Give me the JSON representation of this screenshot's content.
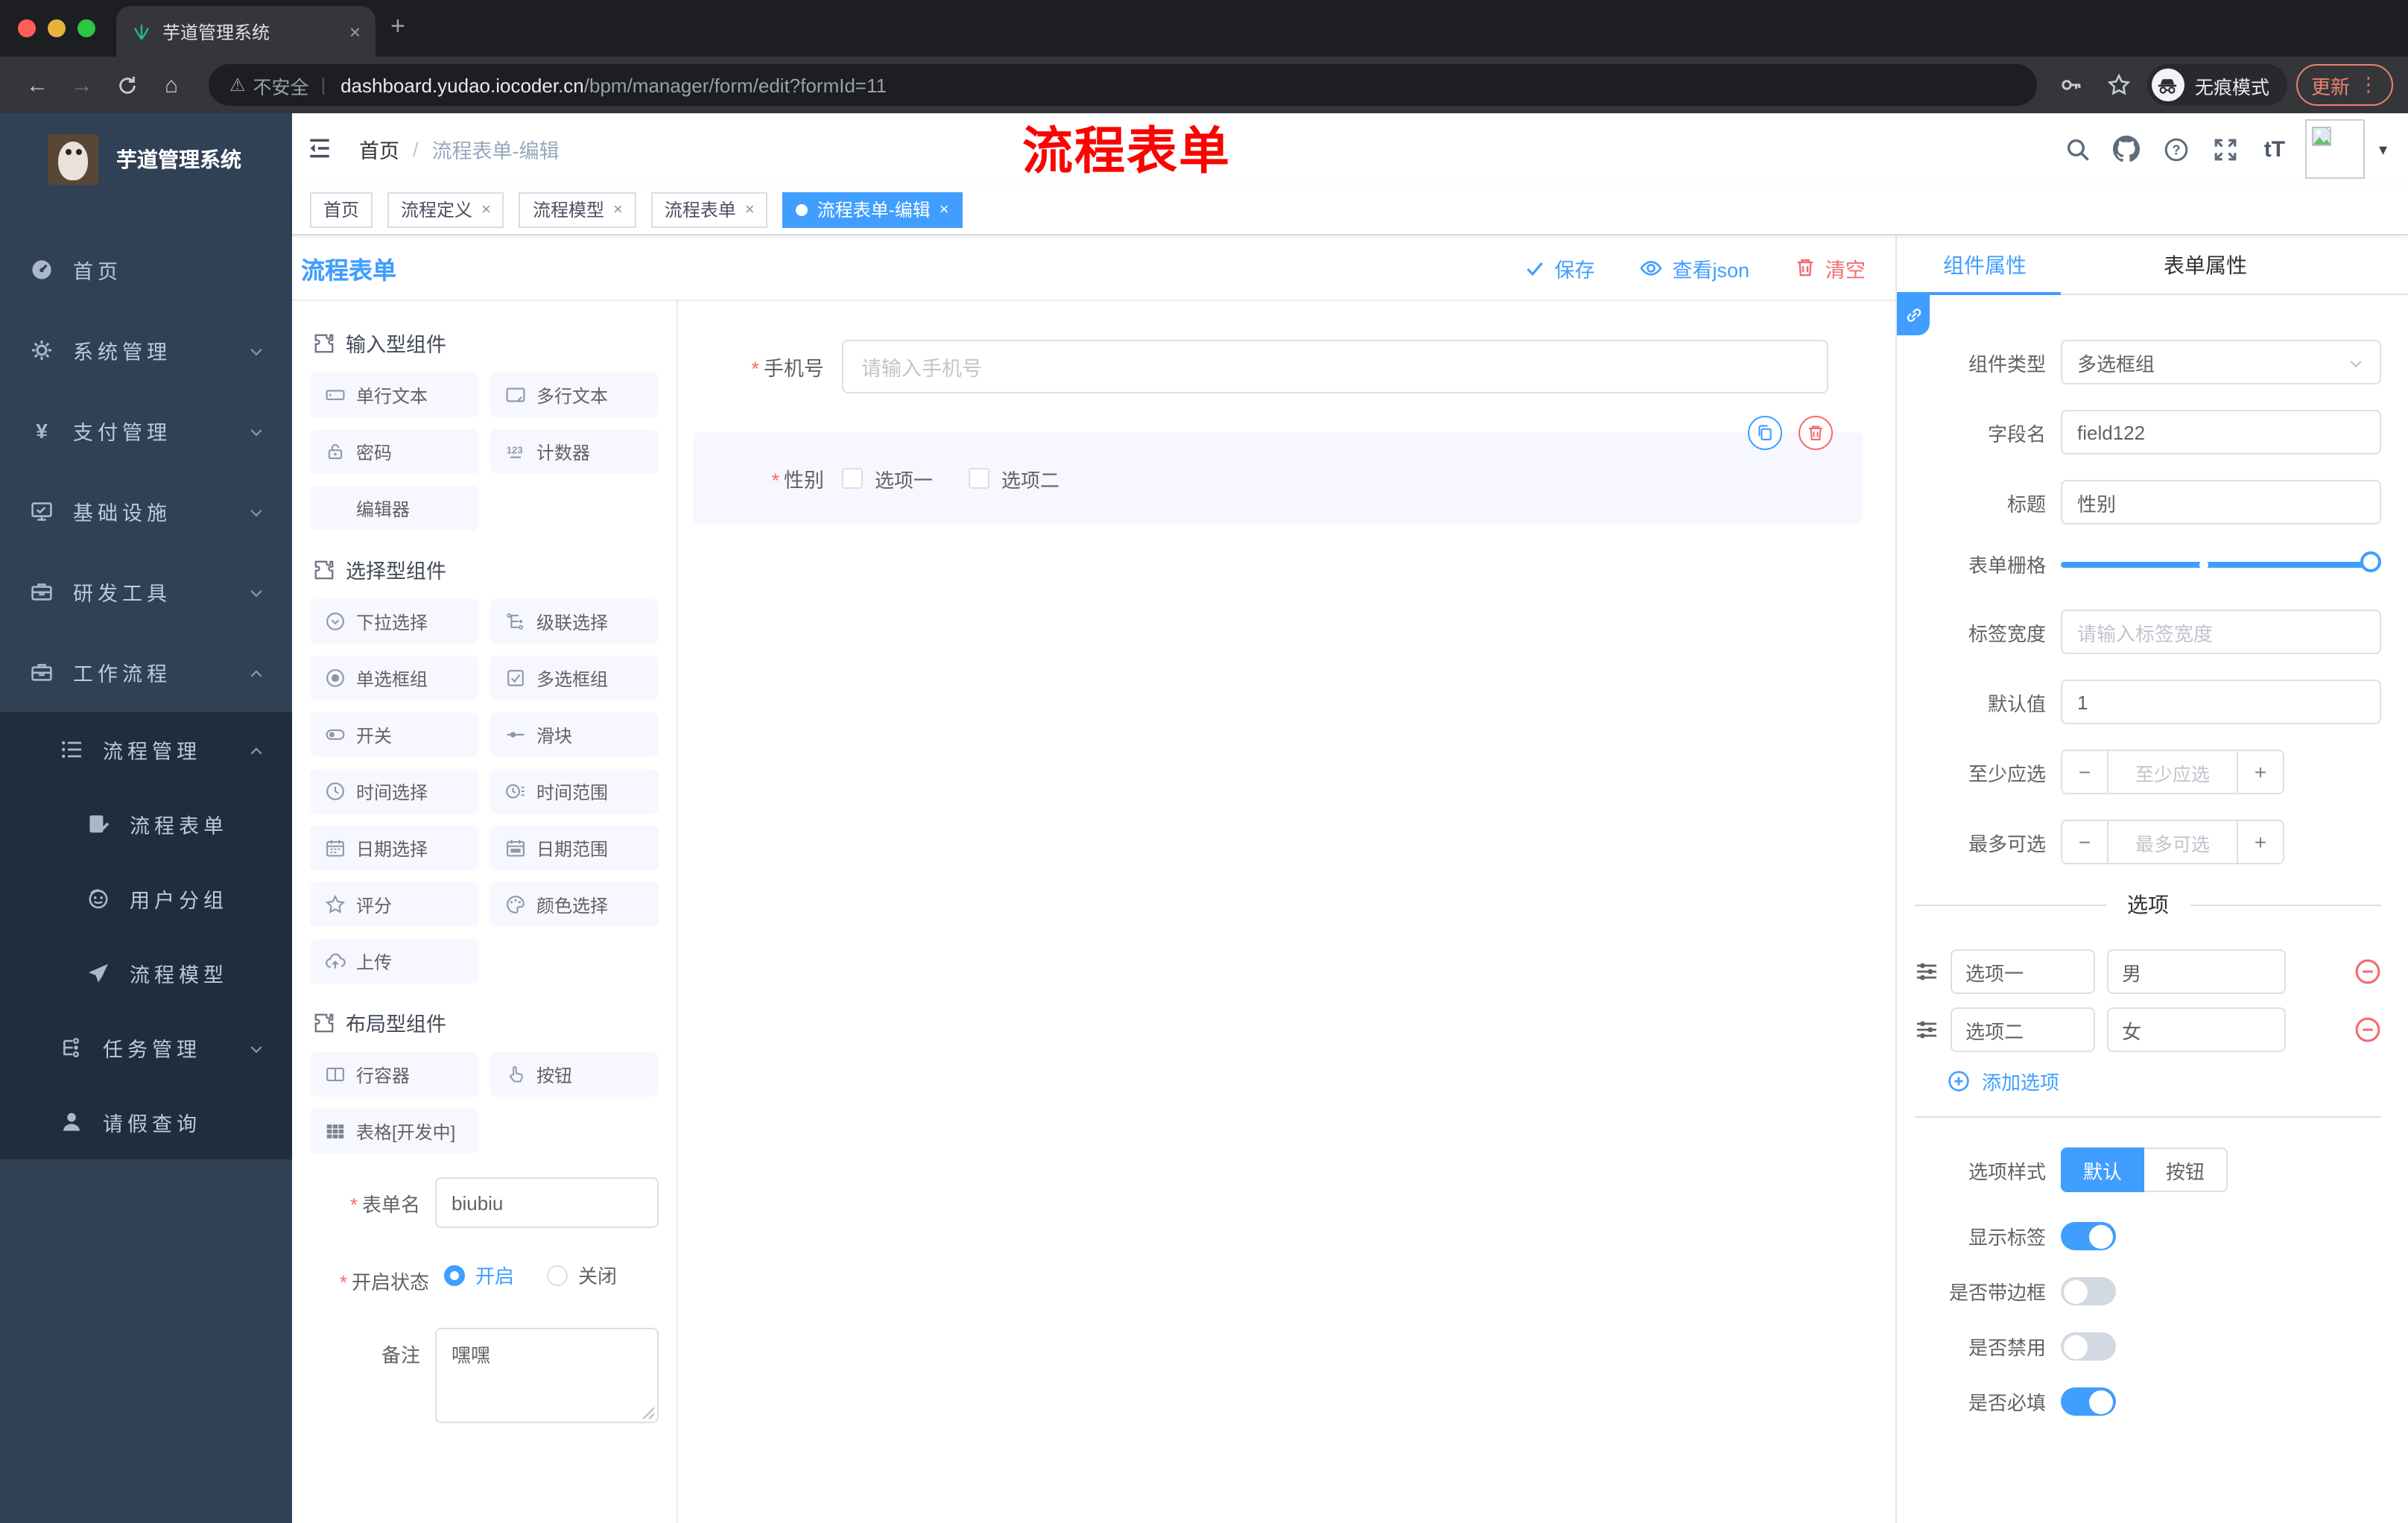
{
  "misc": {
    "required": "*",
    "minus": "−",
    "plus": "+",
    "close": "×",
    "new_tab": "+",
    "dots": "⋮",
    "caret": "▾",
    "slash": "/",
    "warn": "⚠",
    "back": "←",
    "forward": "→",
    "home": "⌂",
    "pipe": "|",
    "font_size": "tT"
  },
  "colors": {
    "primary": "#409eff",
    "danger": "#f56c6c",
    "annotation_red": "#fb0300",
    "sidebar_bg": "#304156",
    "sidebar_sub_bg": "#1f2d3d"
  },
  "browser": {
    "tab_title": "芋道管理系统",
    "not_secure": "不安全",
    "url_host": "dashboard.yudao.iocoder.cn",
    "url_path": "/bpm/manager/form/edit?formId=11",
    "incognito_label": "无痕模式",
    "update_label": "更新"
  },
  "sidebar": {
    "brand": "芋道管理系统",
    "items": [
      {
        "label": "首页"
      },
      {
        "label": "系统管理"
      },
      {
        "label": "支付管理"
      },
      {
        "label": "基础设施"
      },
      {
        "label": "研发工具"
      },
      {
        "label": "工作流程"
      },
      {
        "label": "流程管理"
      },
      {
        "label": "流程表单"
      },
      {
        "label": "用户分组"
      },
      {
        "label": "流程模型"
      },
      {
        "label": "任务管理"
      },
      {
        "label": "请假查询"
      }
    ]
  },
  "header": {
    "breadcrumb_home": "首页",
    "breadcrumb_current": "流程表单-编辑",
    "annotation": "流程表单"
  },
  "tags": [
    {
      "label": "首页"
    },
    {
      "label": "流程定义"
    },
    {
      "label": "流程模型"
    },
    {
      "label": "流程表单"
    },
    {
      "label": "流程表单-编辑"
    }
  ],
  "designer": {
    "title": "流程表单",
    "toolbar": {
      "save": "保存",
      "view_json": "查看json",
      "clear": "清空"
    },
    "sections": [
      {
        "title": "输入型组件",
        "items": [
          {
            "label": "单行文本"
          },
          {
            "label": "多行文本"
          },
          {
            "label": "密码"
          },
          {
            "label": "计数器"
          },
          {
            "label": "编辑器"
          }
        ]
      },
      {
        "title": "选择型组件",
        "items": [
          {
            "label": "下拉选择"
          },
          {
            "label": "级联选择"
          },
          {
            "label": "单选框组"
          },
          {
            "label": "多选框组"
          },
          {
            "label": "开关"
          },
          {
            "label": "滑块"
          },
          {
            "label": "时间选择"
          },
          {
            "label": "时间范围"
          },
          {
            "label": "日期选择"
          },
          {
            "label": "日期范围"
          },
          {
            "label": "评分"
          },
          {
            "label": "颜色选择"
          },
          {
            "label": "上传"
          }
        ]
      },
      {
        "title": "布局型组件",
        "items": [
          {
            "label": "行容器"
          },
          {
            "label": "按钮"
          },
          {
            "label": "表格[开发中]"
          }
        ]
      }
    ],
    "form": {
      "name_label": "表单名",
      "name_value": "biubiu",
      "status_label": "开启状态",
      "status_on": "开启",
      "status_off": "关闭",
      "remark_label": "备注",
      "remark_value": "嘿嘿"
    }
  },
  "canvas": {
    "phone_label": "手机号",
    "phone_placeholder": "请输入手机号",
    "gender_label": "性别",
    "gender_options": [
      {
        "label": "选项一"
      },
      {
        "label": "选项二"
      }
    ]
  },
  "panel": {
    "tab_component": "组件属性",
    "tab_form": "表单属性",
    "component_type_label": "组件类型",
    "component_type_value": "多选框组",
    "field_name_label": "字段名",
    "field_name_value": "field122",
    "title_label": "标题",
    "title_value": "性别",
    "grid_label": "表单栅格",
    "label_width_label": "标签宽度",
    "label_width_placeholder": "请输入标签宽度",
    "default_label": "默认值",
    "default_value": "1",
    "min_label": "至少应选",
    "min_placeholder": "至少应选",
    "max_label": "最多可选",
    "max_placeholder": "最多可选",
    "options_title": "选项",
    "options": [
      {
        "label": "选项一",
        "value": "男"
      },
      {
        "label": "选项二",
        "value": "女"
      }
    ],
    "add_option": "添加选项",
    "option_style_label": "选项样式",
    "style_default": "默认",
    "style_button": "按钮",
    "show_label_label": "显示标签",
    "border_label": "是否带边框",
    "disabled_label": "是否禁用",
    "required_label": "是否必填"
  }
}
